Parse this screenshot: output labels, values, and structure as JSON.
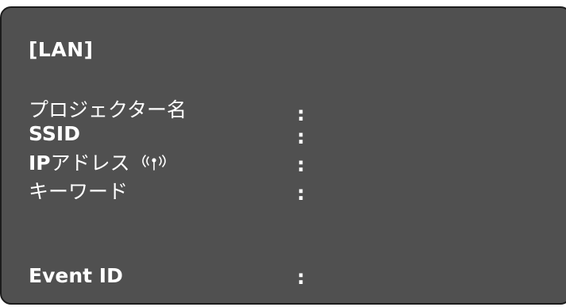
{
  "panel": {
    "title": "[LAN]",
    "separator": ":",
    "rows": [
      {
        "label": "プロジェクター名"
      },
      {
        "label": "SSID"
      },
      {
        "label_prefix": "IP",
        "label_suffix": "アドレス",
        "icon": "wifi-antenna-icon"
      },
      {
        "label": "キーワード"
      },
      {
        "label": "Event ID"
      }
    ]
  },
  "colors": {
    "background": "#505050",
    "border": "#1c1c1c",
    "text": "#ffffff"
  }
}
